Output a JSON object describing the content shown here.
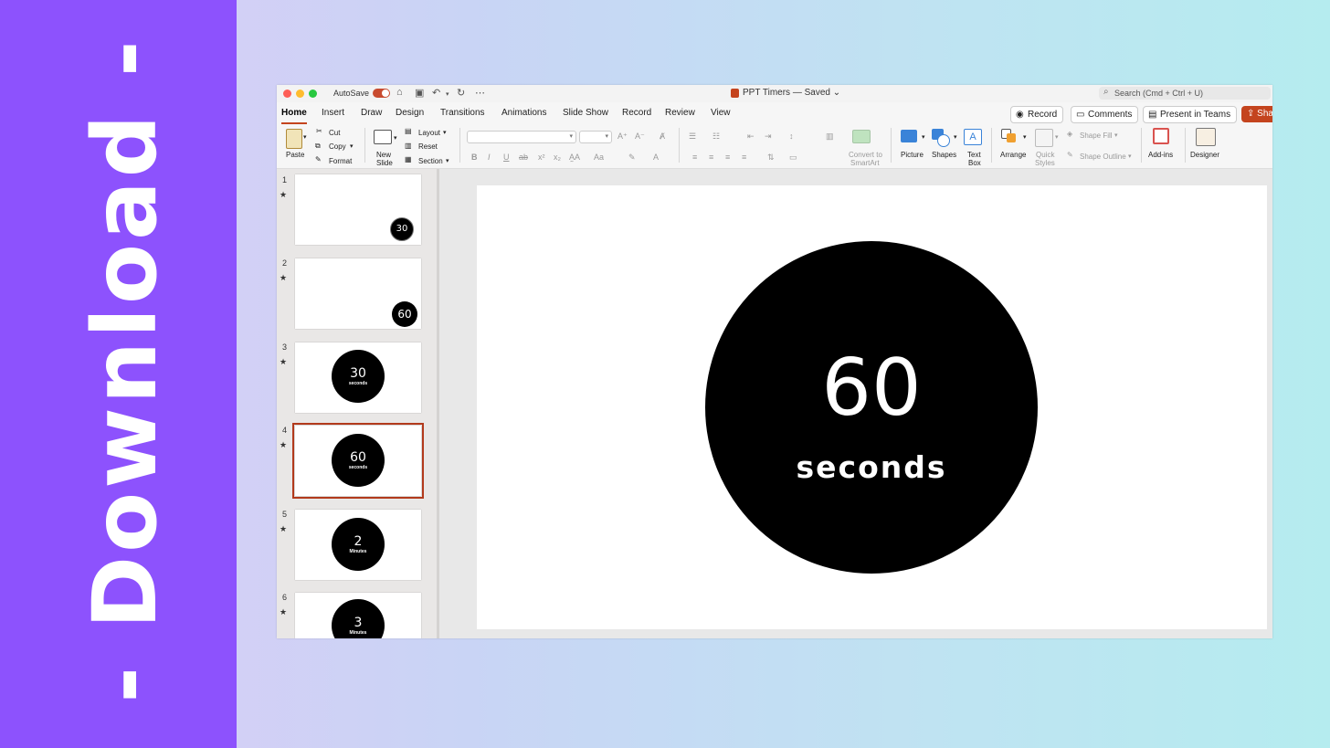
{
  "promo": {
    "text": "- Download -"
  },
  "window": {
    "title": "PPT Timers — Saved ⌄",
    "autosave_label": "AutoSave",
    "search_placeholder": "Search (Cmd + Ctrl + U)",
    "traffic_colors": [
      "#fe5f57",
      "#febc2e",
      "#28c840"
    ]
  },
  "tabs": [
    "Home",
    "Insert",
    "Draw",
    "Design",
    "Transitions",
    "Animations",
    "Slide Show",
    "Record",
    "Review",
    "View"
  ],
  "actions": {
    "record": "Record",
    "comments": "Comments",
    "present": "Present in Teams",
    "share": "Sha"
  },
  "ribbon": {
    "paste": "Paste",
    "cut": "Cut",
    "copy": "Copy",
    "format": "Format",
    "new_slide_1": "New",
    "new_slide_2": "Slide",
    "layout": "Layout",
    "reset": "Reset",
    "section": "Section",
    "convert_1": "Convert to",
    "convert_2": "SmartArt",
    "picture": "Picture",
    "shapes": "Shapes",
    "textbox_1": "Text",
    "textbox_2": "Box",
    "arrange": "Arrange",
    "quick_1": "Quick",
    "quick_2": "Styles",
    "shape_fill": "Shape Fill",
    "shape_outline": "Shape Outline",
    "addins": "Add-ins",
    "designer": "Designer"
  },
  "slides": [
    {
      "num": "1",
      "star": "★",
      "value": "30",
      "unit": ""
    },
    {
      "num": "2",
      "star": "★",
      "value": "60",
      "unit": ""
    },
    {
      "num": "3",
      "star": "★",
      "value": "30",
      "unit": "seconds"
    },
    {
      "num": "4",
      "star": "★",
      "value": "60",
      "unit": "seconds"
    },
    {
      "num": "5",
      "star": "★",
      "value": "2",
      "unit": "Minutes"
    },
    {
      "num": "6",
      "star": "★",
      "value": "3",
      "unit": "Minutes"
    }
  ],
  "current_slide": {
    "value": "60",
    "unit": "seconds"
  },
  "colors": {
    "accent": "#c4441e",
    "left_panel": "#8d52fd"
  }
}
